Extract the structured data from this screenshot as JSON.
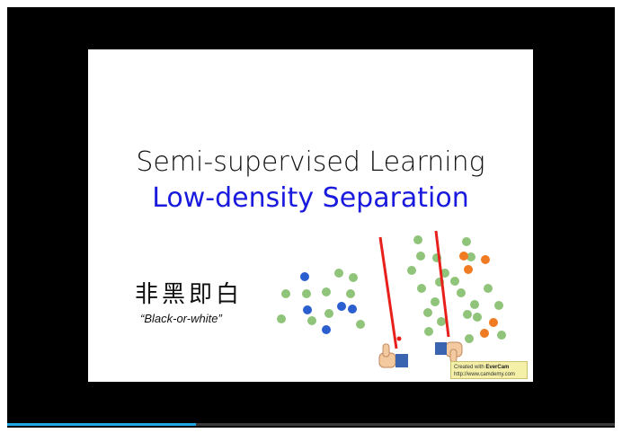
{
  "slide": {
    "title_line1": "Semi-supervised Learning",
    "title_line2": "Low-density Separation",
    "chinese_phrase": "非黑即白",
    "english_phrase": "“Black-or-white”"
  },
  "watermark": {
    "line1_prefix": "Created with ",
    "line1_brand": "EverCam",
    "line2": "http://www.camdemy.com"
  },
  "player": {
    "progress_fraction": 0.31
  },
  "colors": {
    "title_line2": "#1a1adf",
    "unlabeled_dot": "#8fc47a",
    "class_blue": "#2b5fd0",
    "class_orange": "#f07b22",
    "boundary_line": "#e8201c"
  },
  "icons": {
    "thumb_up": "thumb-up-icon",
    "thumb_down": "thumb-down-icon"
  }
}
